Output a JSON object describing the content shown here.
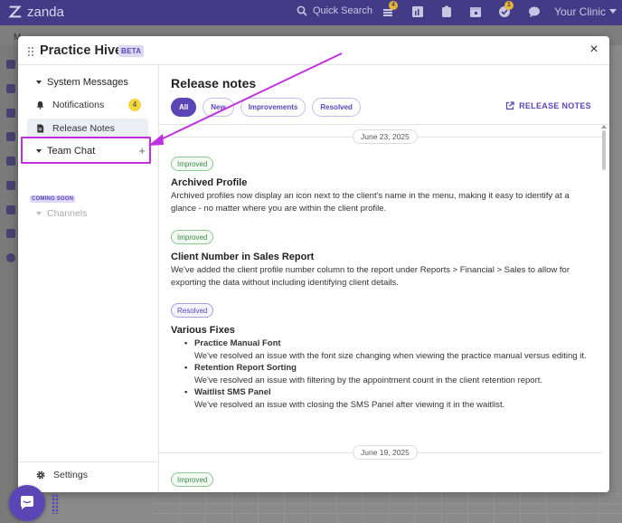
{
  "app": {
    "brand": "zanda",
    "search_label": "Quick Search",
    "clinic": "Your Clinic",
    "badges": {
      "notifications": "4",
      "tasks": "1"
    },
    "bg_first_letter": "M"
  },
  "modal": {
    "title": "Practice Hive",
    "beta_label": "BETA",
    "close_label": "×"
  },
  "sidebar": {
    "system_messages": "System Messages",
    "notifications": {
      "label": "Notifications",
      "count": "4"
    },
    "release_notes": "Release Notes",
    "team_chat": "Team Chat",
    "add_label": "+",
    "coming_soon": "COMING SOON",
    "channels": "Channels",
    "settings": "Settings"
  },
  "main": {
    "title": "Release notes",
    "filters": [
      "All",
      "New",
      "Improvements",
      "Resolved"
    ],
    "release_notes_link": "RELEASE NOTES",
    "sections": [
      {
        "date": "June 23, 2025",
        "entries": [
          {
            "tag": "Improved",
            "title": "Archived Profile",
            "desc": "Archived profiles now display an icon next to the client's name in the menu, making it easy to identify at a glance - no matter where you are within the client profile."
          },
          {
            "tag": "Improved",
            "title": "Client Number in Sales Report",
            "desc": "We've added the client profile number column to the report under Reports > Financial > Sales to allow for exporting the data without including identifying client details."
          },
          {
            "tag": "Resolved",
            "title": "Various Fixes",
            "fixes": [
              {
                "name": "Practice Manual Font",
                "desc": "We've resolved an issue with the font size changing when viewing the practice manual versus editing it."
              },
              {
                "name": "Retention Report Sorting",
                "desc": "We've resolved an issue with filtering by the appointment count in the client retention report."
              },
              {
                "name": "Waitlist SMS Panel",
                "desc": "We've resolved an issue with closing the SMS Panel after viewing it in the waitlist."
              }
            ]
          }
        ]
      },
      {
        "date": "June 19, 2025",
        "entries": [
          {
            "tag": "Improved"
          }
        ]
      }
    ]
  },
  "colors": {
    "brand_purple": "#433b86",
    "accent": "#5b46b5",
    "annotation": "#c02fe0",
    "improved_green": "#3f8a47",
    "badge_yellow": "#f3d544"
  }
}
